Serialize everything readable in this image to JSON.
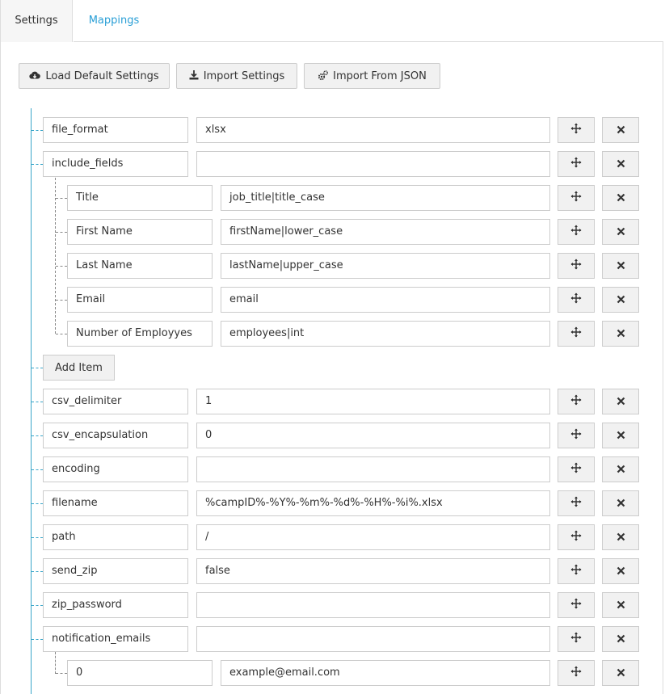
{
  "tabs": {
    "settings": "Settings",
    "mappings": "Mappings"
  },
  "toolbar": {
    "load_default": "Load Default Settings",
    "import_settings": "Import Settings",
    "import_json": "Import From JSON"
  },
  "icons": {
    "load_default": "cloud-download-icon",
    "import_settings": "download-icon",
    "import_json": "gears-icon",
    "move": "arrows-move-icon",
    "delete": "close-icon"
  },
  "rows": [
    {
      "key": "file_format",
      "value": "xlsx"
    },
    {
      "key": "include_fields",
      "value": ""
    },
    {
      "key": "Title",
      "value": "job_title|title_case"
    },
    {
      "key": "First Name",
      "value": "firstName|lower_case"
    },
    {
      "key": "Last Name",
      "value": "lastName|upper_case"
    },
    {
      "key": "Email",
      "value": "email"
    },
    {
      "key": "Number of Employyes",
      "value": "employees|int"
    },
    {
      "key": "csv_delimiter",
      "value": "1"
    },
    {
      "key": "csv_encapsulation",
      "value": "0"
    },
    {
      "key": "encoding",
      "value": ""
    },
    {
      "key": "filename",
      "value": "%campID%-%Y%-%m%-%d%-%H%-%i%.xlsx"
    },
    {
      "key": "path",
      "value": "/"
    },
    {
      "key": "send_zip",
      "value": "false"
    },
    {
      "key": "zip_password",
      "value": ""
    },
    {
      "key": "notification_emails",
      "value": ""
    },
    {
      "key": "0",
      "value": "example@email.com"
    }
  ],
  "add_item": "Add Item",
  "colors": {
    "accent": "#2a9fd6",
    "tree_line": "#3aa6c9",
    "button_bg": "#f1f1f1",
    "border": "#cccccc"
  }
}
